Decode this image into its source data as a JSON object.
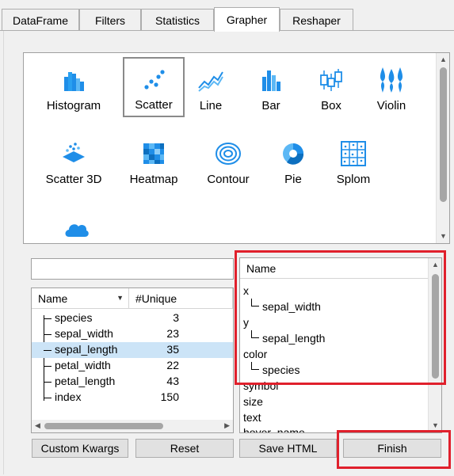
{
  "tabs": [
    {
      "label": "DataFrame"
    },
    {
      "label": "Filters"
    },
    {
      "label": "Statistics"
    },
    {
      "label": "Grapher",
      "active": true
    },
    {
      "label": "Reshaper"
    }
  ],
  "chart_types": [
    {
      "label": "Histogram",
      "icon": "histogram-icon"
    },
    {
      "label": "Scatter",
      "icon": "scatter-icon",
      "selected": true
    },
    {
      "label": "Line",
      "icon": "line-chart-icon"
    },
    {
      "label": "Bar",
      "icon": "bar-chart-icon"
    },
    {
      "label": "Box",
      "icon": "box-plot-icon"
    },
    {
      "label": "Violin",
      "icon": "violin-plot-icon"
    },
    {
      "label": "Scatter 3D",
      "icon": "scatter-3d-icon"
    },
    {
      "label": "Heatmap",
      "icon": "heatmap-icon"
    },
    {
      "label": "Contour",
      "icon": "contour-icon"
    },
    {
      "label": "Pie",
      "icon": "pie-chart-icon"
    },
    {
      "label": "Splom",
      "icon": "splom-icon"
    },
    {
      "label": "",
      "icon": "cloud-icon"
    }
  ],
  "filter": {
    "value": "",
    "placeholder": ""
  },
  "columns_table": {
    "headers": {
      "name": "Name",
      "unique": "#Unique"
    },
    "rows": [
      {
        "name": "species",
        "unique": "3"
      },
      {
        "name": "sepal_width",
        "unique": "23"
      },
      {
        "name": "sepal_length",
        "unique": "35",
        "selected": true
      },
      {
        "name": "petal_width",
        "unique": "22"
      },
      {
        "name": "petal_length",
        "unique": "43"
      },
      {
        "name": "index",
        "unique": "150"
      }
    ]
  },
  "mapping_table": {
    "header": "Name",
    "items": [
      {
        "label": "x",
        "child": "sepal_width"
      },
      {
        "label": "y",
        "child": "sepal_length"
      },
      {
        "label": "color",
        "child": "species"
      },
      {
        "label": "symbol"
      },
      {
        "label": "size"
      },
      {
        "label": "text"
      },
      {
        "label": "hover_name"
      }
    ]
  },
  "buttons": {
    "custom_kwargs": "Custom Kwargs",
    "reset": "Reset",
    "save_html": "Save HTML",
    "finish": "Finish"
  },
  "colors": {
    "accent_blue": "#1f8ee8",
    "highlight_red": "#e0202c",
    "selection": "#cce4f7"
  }
}
